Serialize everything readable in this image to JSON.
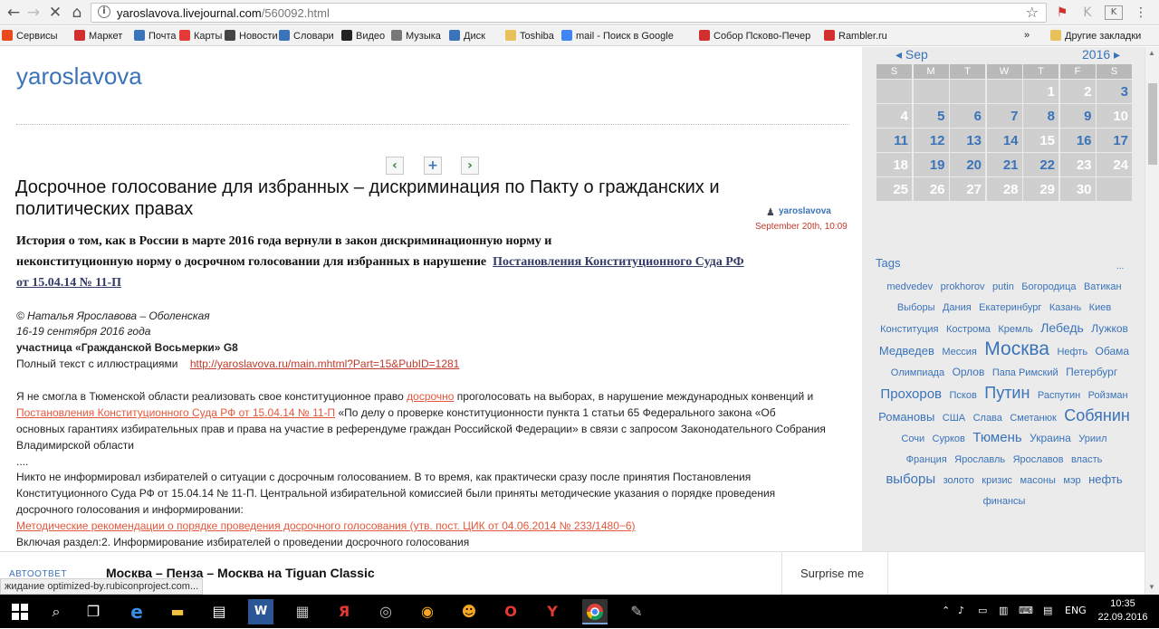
{
  "browser": {
    "url_host": "yaroslavova.livejournal.com",
    "url_path": "/560092.html",
    "bookmarks": [
      {
        "label": "Сервисы",
        "color": "#e84a1c"
      },
      {
        "label": "Маркет",
        "color": "#d32f2f"
      },
      {
        "label": "Почта",
        "color": "#3b73b9"
      },
      {
        "label": "Карты",
        "color": "#e53935"
      },
      {
        "label": "Новости",
        "color": "#444"
      },
      {
        "label": "Словари",
        "color": "#3b73b9"
      },
      {
        "label": "Видео",
        "color": "#222"
      },
      {
        "label": "Музыка",
        "color": "#777"
      },
      {
        "label": "Диск",
        "color": "#3b73b9"
      },
      {
        "label": "Toshiba",
        "color": "#e8c15a"
      },
      {
        "label": "mail - Поиск в Google",
        "color": "#4285f4"
      },
      {
        "label": "Собор Псково-Печер",
        "color": "#d32f2f"
      },
      {
        "label": "Rambler.ru",
        "color": "#d32f2f"
      }
    ],
    "bookmarks_more": "»",
    "other_bookmarks": "Другие закладки"
  },
  "blog": {
    "title": "yaroslavova"
  },
  "post": {
    "title": "Досрочное голосование для избранных – дискриминация по Пакту о гражданских и политических правах",
    "author": "yaroslavova",
    "date": "September 20th, 10:09",
    "lead_line1": "История о том, как в России в марте 2016 года вернули в закон дискриминационную норму и",
    "lead_line2": "неконституционную норму о досрочном голосовании для избранных в нарушение",
    "lead_link": "Постановления Конституционного Суда РФ",
    "lead_link2": "от 15.04.14 № 11-П",
    "copyright": "© Наталья Ярославова – Оболенская",
    "dates": "16-19 сентября 2016 года",
    "participant": "участница «Гражданской Восьмерки» G8",
    "fulltext_label": "Полный текст с иллюстрациями",
    "fulltext_link": "http://yaroslavova.ru/main.mhtml?Part=15&PubID=1281",
    "p1_a": "Я не смогла в Тюменской области реализовать свое конституционное право ",
    "p1_link1": "досрочно",
    "p1_b": " проголосовать на выборах, в нарушение международных конвенций и",
    "p1_link2": "Постановления Конституционного Суда РФ от 15.04.14 № 11-П",
    "p1_c": " «По делу о проверке конституционности пункта 1 статьи 65 Федерального закона «Об",
    "p1_d": "основных гарантиях избирательных прав и права на участие в референдуме граждан Российской Федерации» в связи с запросом Законодательного Собрания",
    "p1_e": "Владимирской области",
    "ellipsis": "....",
    "p2_a": "Никто не информировал избирателей о ситуации с досрочным голосованием. В то время, как практически сразу после принятия Постановления",
    "p2_b": "Конституционного Суда РФ от 15.04.14 № 11-П. Центральной избирательной комиссией были приняты методические указания о порядке проведения",
    "p2_c": "досрочного голосования и информировании:",
    "p2_link": "Методические рекомендации о порядке проведения досрочного голосования (утв. пост. ЦИК от 04.06.2014 № 233/1480−6)",
    "p3": "Включая раздел:2. Информирование избирателей о проведении досрочного голосования"
  },
  "calendar": {
    "month": "Sep",
    "year": "2016",
    "dow": [
      "S",
      "M",
      "T",
      "W",
      "T",
      "F",
      "S"
    ],
    "weeks": [
      [
        "",
        "",
        "",
        "",
        "1",
        "2",
        "3"
      ],
      [
        "4",
        "5",
        "6",
        "7",
        "8",
        "9",
        "10"
      ],
      [
        "11",
        "12",
        "13",
        "14",
        "15",
        "16",
        "17"
      ],
      [
        "18",
        "19",
        "20",
        "21",
        "22",
        "23",
        "24"
      ],
      [
        "25",
        "26",
        "27",
        "28",
        "29",
        "30",
        ""
      ]
    ],
    "linked": [
      "3",
      "5",
      "6",
      "7",
      "8",
      "9",
      "11",
      "12",
      "13",
      "14",
      "16",
      "17",
      "19",
      "20",
      "21",
      "22"
    ]
  },
  "tags": {
    "heading": "Tags",
    "more": "...",
    "items": [
      {
        "t": "medvedev",
        "s": 11
      },
      {
        "t": "prokhorov",
        "s": 11
      },
      {
        "t": "putin",
        "s": 11
      },
      {
        "t": "Богородица",
        "s": 11
      },
      {
        "t": "Ватикан",
        "s": 11
      },
      {
        "t": "Выборы",
        "s": 11
      },
      {
        "t": "Дания",
        "s": 11
      },
      {
        "t": "Екатеринбург",
        "s": 11
      },
      {
        "t": "Казань",
        "s": 11
      },
      {
        "t": "Киев",
        "s": 11
      },
      {
        "t": "Конституция",
        "s": 11
      },
      {
        "t": "Кострома",
        "s": 11
      },
      {
        "t": "Кремль",
        "s": 11
      },
      {
        "t": "Лебедь",
        "s": 14
      },
      {
        "t": "Лужков",
        "s": 12
      },
      {
        "t": "Медведев",
        "s": 13
      },
      {
        "t": "Мессия",
        "s": 11
      },
      {
        "t": "Москва",
        "s": 21
      },
      {
        "t": "Нефть",
        "s": 11
      },
      {
        "t": "Обама",
        "s": 12
      },
      {
        "t": "Олимпиада",
        "s": 11
      },
      {
        "t": "Орлов",
        "s": 12
      },
      {
        "t": "Папа Римский",
        "s": 11
      },
      {
        "t": "Петербург",
        "s": 12
      },
      {
        "t": "Прохоров",
        "s": 15
      },
      {
        "t": "Псков",
        "s": 11
      },
      {
        "t": "Путин",
        "s": 18
      },
      {
        "t": "Распутин",
        "s": 11
      },
      {
        "t": "Ройзман",
        "s": 11
      },
      {
        "t": "Романовы",
        "s": 13
      },
      {
        "t": "США",
        "s": 11
      },
      {
        "t": "Слава",
        "s": 11
      },
      {
        "t": "Сметанюк",
        "s": 11
      },
      {
        "t": "Собянин",
        "s": 18
      },
      {
        "t": "Сочи",
        "s": 11
      },
      {
        "t": "Сурков",
        "s": 11
      },
      {
        "t": "Тюмень",
        "s": 15
      },
      {
        "t": "Украина",
        "s": 12
      },
      {
        "t": "Уриил",
        "s": 11
      },
      {
        "t": "Франция",
        "s": 11
      },
      {
        "t": "Ярославль",
        "s": 11
      },
      {
        "t": "Ярославов",
        "s": 11
      },
      {
        "t": "власть",
        "s": 11
      },
      {
        "t": "выборы",
        "s": 15
      },
      {
        "t": "золото",
        "s": 11
      },
      {
        "t": "кризис",
        "s": 11
      },
      {
        "t": "масоны",
        "s": 11
      },
      {
        "t": "мэр",
        "s": 11
      },
      {
        "t": "нефть",
        "s": 13
      },
      {
        "t": "финансы",
        "s": 11
      }
    ]
  },
  "bottom": {
    "autoresponse": "АВТООТВЕТ",
    "news_title": "Москва – Пенза – Москва на Tiguan Classic",
    "surprise": "Surprise me"
  },
  "status": "жидание optimized-by.rubiconproject.com...",
  "taskbar": {
    "lang": "ENG",
    "time": "10:35",
    "date": "22.09.2016"
  }
}
